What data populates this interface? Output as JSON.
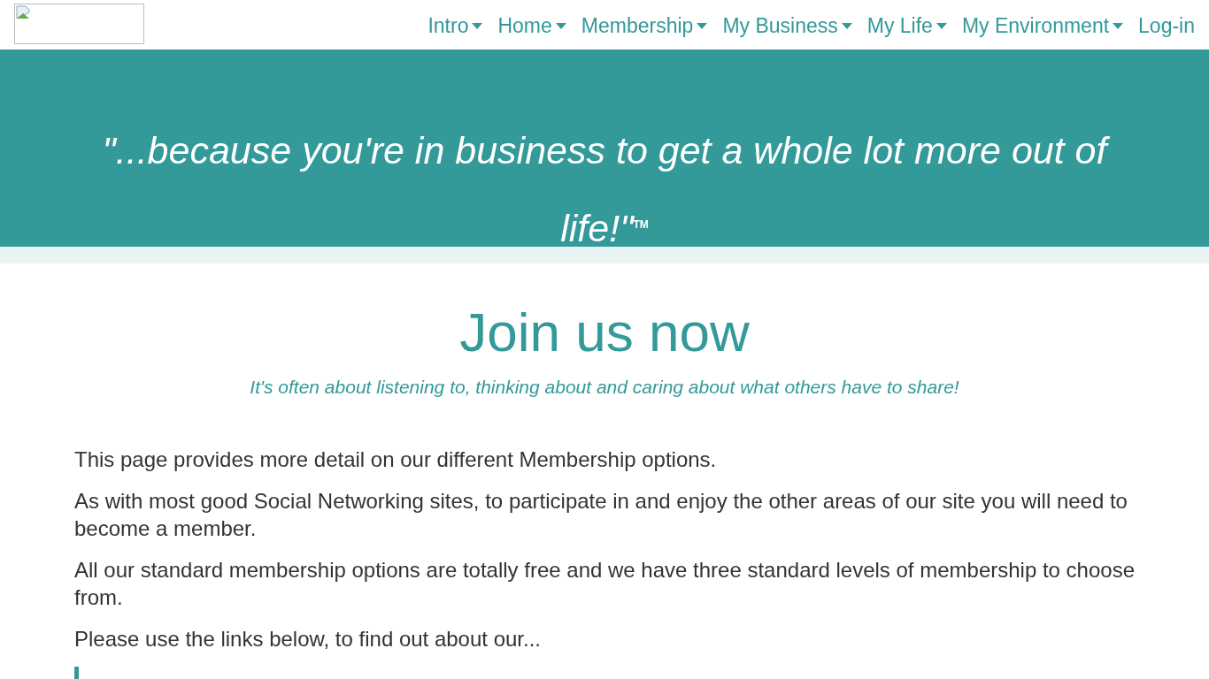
{
  "nav": {
    "items": [
      {
        "label": "Intro",
        "dropdown": true
      },
      {
        "label": "Home",
        "dropdown": true
      },
      {
        "label": "Membership",
        "dropdown": true
      },
      {
        "label": "My Business",
        "dropdown": true
      },
      {
        "label": "My Life",
        "dropdown": true
      },
      {
        "label": "My Environment",
        "dropdown": true
      },
      {
        "label": "Log-in",
        "dropdown": false
      }
    ]
  },
  "banner": {
    "quote": "\"...because you're in business to get a whole lot more out of life!\"$^{TM}$"
  },
  "main": {
    "heading": "Join us now",
    "tagline": "It's often about listening to, thinking about and caring about what others have to share!",
    "paragraphs": [
      "This page provides more detail on our different Membership options.",
      "As with most good Social Networking sites, to participate in and enjoy the other areas of our site you will need to become a member.",
      "All our standard membership options are totally free and we have three standard levels of membership to choose from.",
      "Please use the links below, to find out about our..."
    ]
  }
}
